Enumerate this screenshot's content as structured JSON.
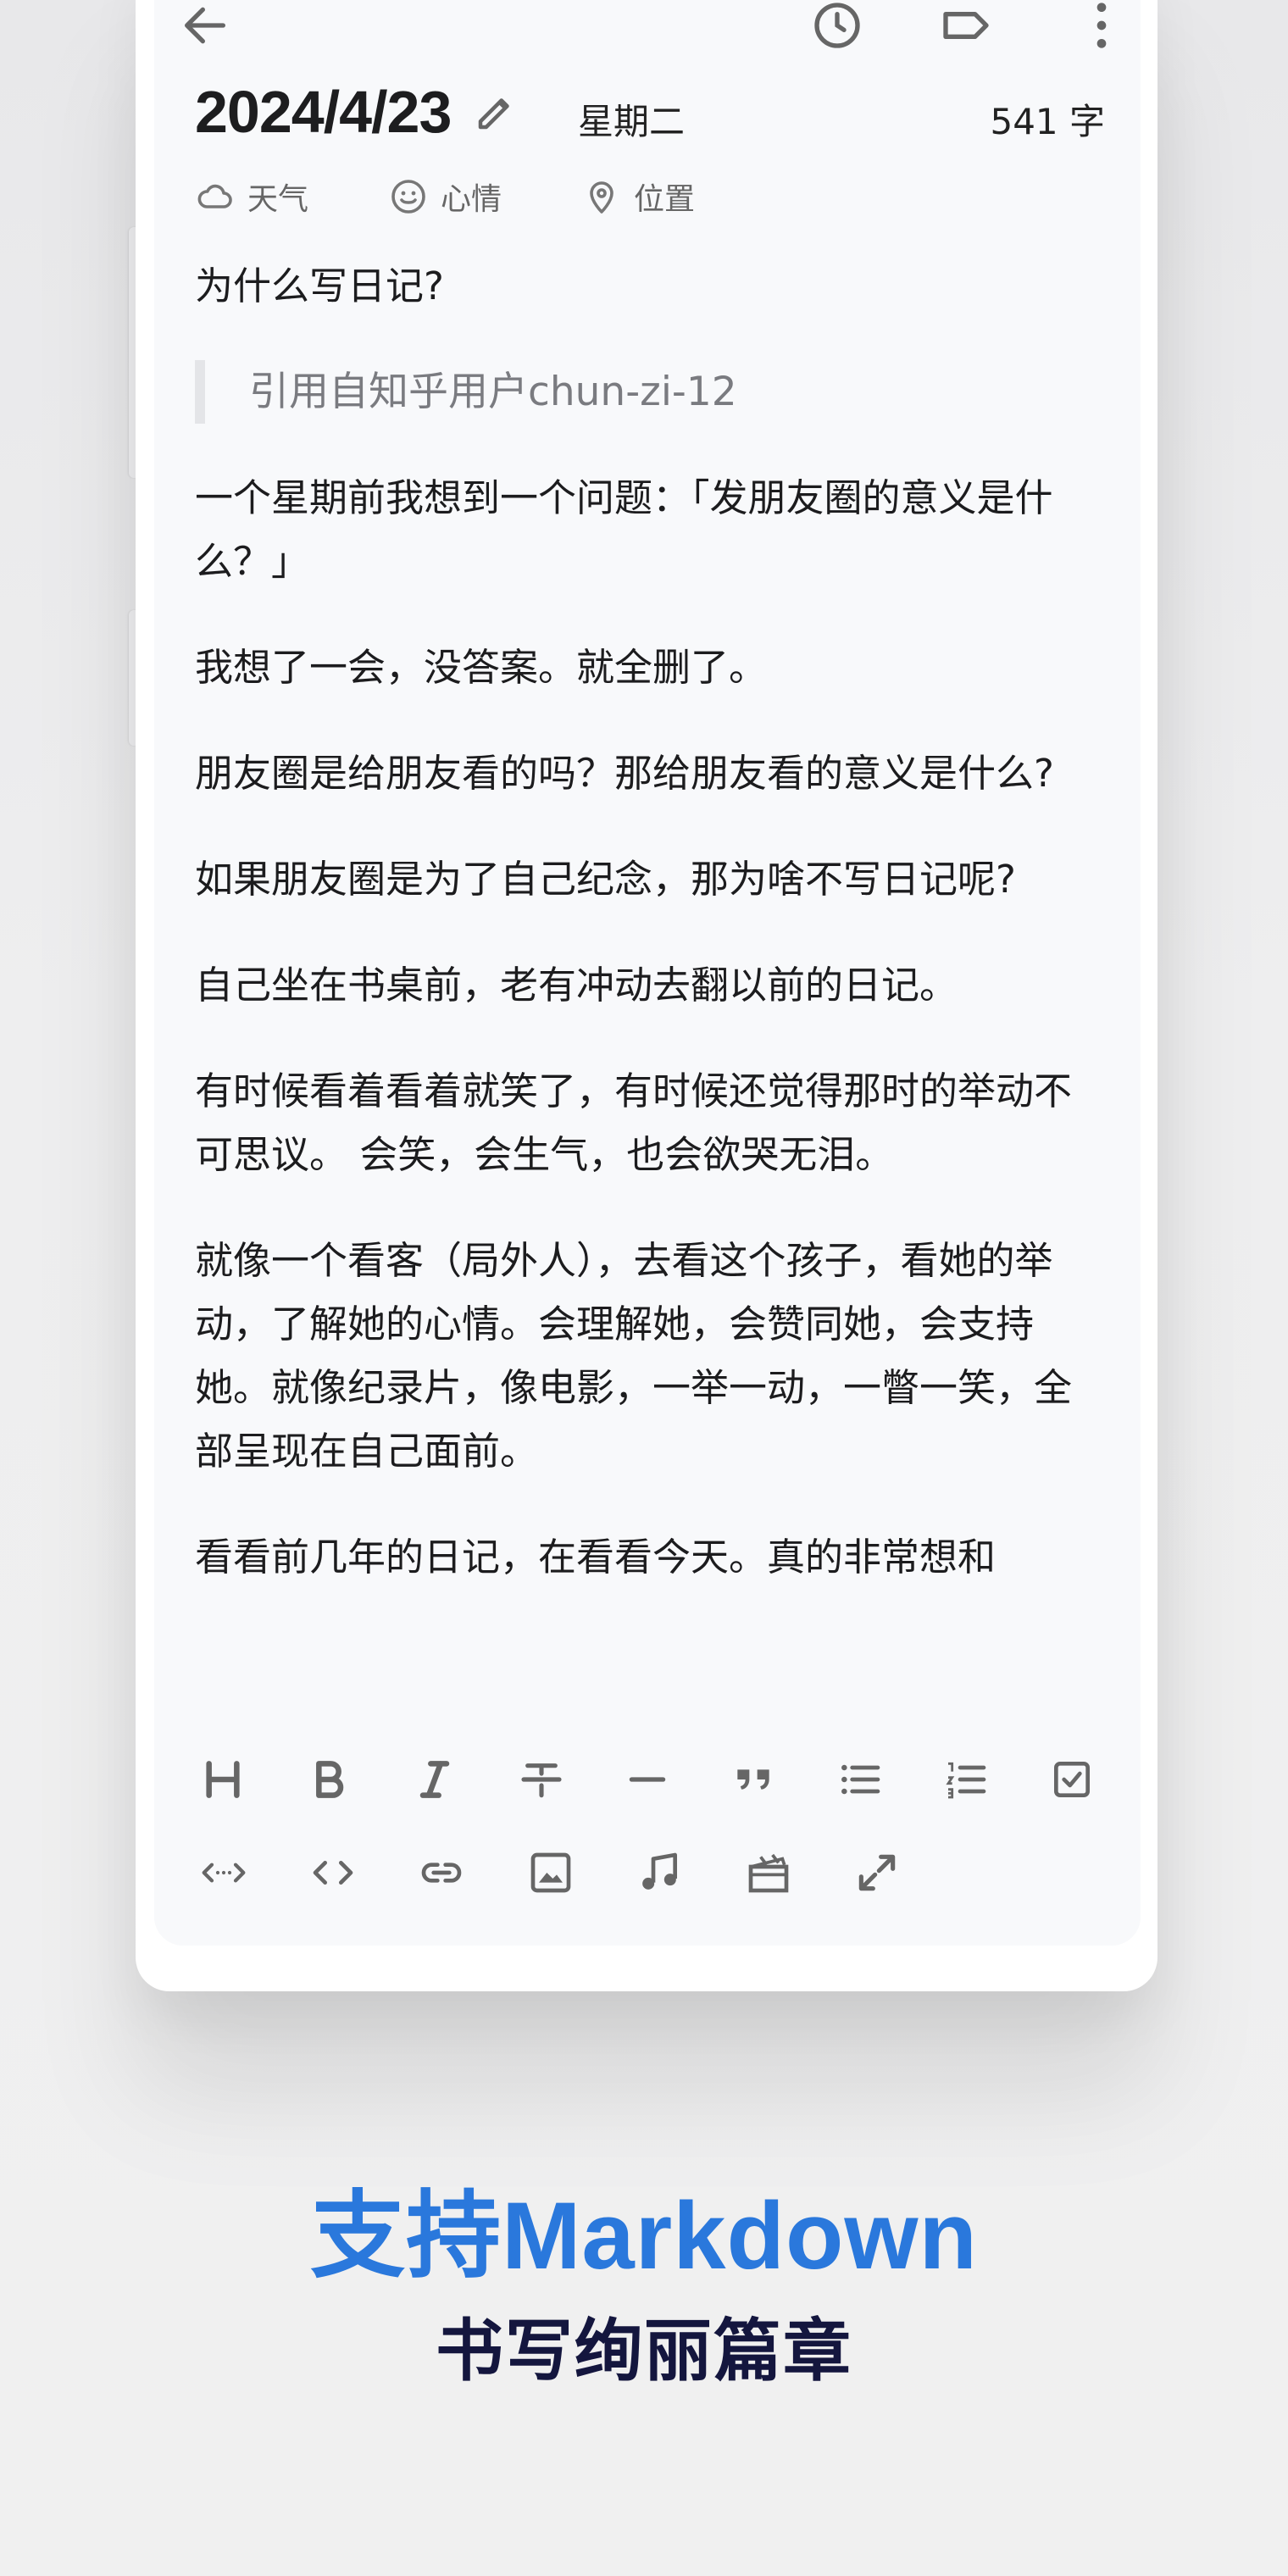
{
  "header": {
    "date": "2024/4/23",
    "weekday": "星期二",
    "word_count": "541 字",
    "meta": [
      {
        "icon": "cloud-icon",
        "label": "天气"
      },
      {
        "icon": "smile-icon",
        "label": "心情"
      },
      {
        "icon": "location-pin-icon",
        "label": "位置"
      }
    ]
  },
  "appbar": {
    "icons": [
      "back-arrow-icon",
      "history-clock-icon",
      "tag-icon",
      "more-vertical-icon"
    ]
  },
  "content": {
    "heading": "为什么写日记?",
    "quote": "引用自知乎用户chun-zi-12",
    "paragraphs": [
      "一个星期前我想到一个问题：「发朋友圈的意义是什么？」",
      "我想了一会，没答案。就全删了。",
      "朋友圈是给朋友看的吗？那给朋友看的意义是什么?",
      "如果朋友圈是为了自己纪念，那为啥不写日记呢?",
      "自己坐在书桌前，老有冲动去翻以前的日记。",
      "有时候看着看着就笑了，有时候还觉得那时的举动不可思议。 会笑，会生气，也会欲哭无泪。",
      "就像一个看客（局外人），去看这个孩子，看她的举动，了解她的心情。会理解她，会赞同她，会支持她。就像纪录片，像电影，一举一动，一瞥一笑，全部呈现在自己面前。",
      "看看前几年的日记，在看看今天。真的非常想和"
    ]
  },
  "toolbar": {
    "row1": [
      "heading-icon",
      "bold-icon",
      "italic-icon",
      "strikethrough-icon",
      "horizontal-rule-icon",
      "quote-icon",
      "bullet-list-icon",
      "numbered-list-icon",
      "checkbox-icon"
    ],
    "row2": [
      "inline-code-icon",
      "code-block-icon",
      "link-icon",
      "image-icon",
      "music-icon",
      "video-clapper-icon",
      "expand-icon"
    ]
  },
  "caption": {
    "headline": "支持Markdown",
    "subline": "书写绚丽篇章"
  },
  "colors": {
    "headline": "#2a78dc",
    "subline": "#14163e",
    "icon": "#666666",
    "screen_bg": "#f8f9fb"
  }
}
